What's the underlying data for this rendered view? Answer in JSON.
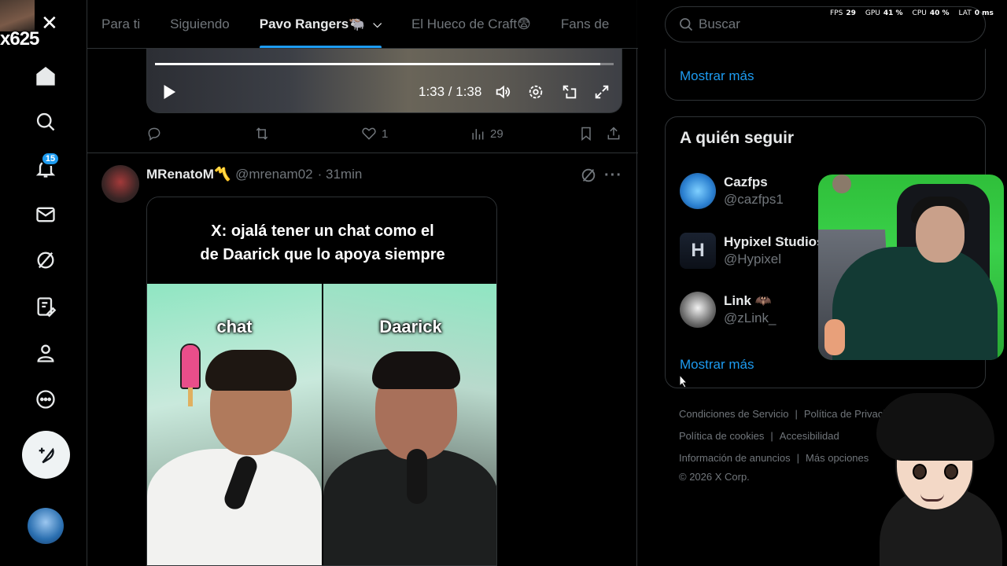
{
  "stream_overlay": {
    "counter": "x625",
    "stats": [
      {
        "label": "FPS",
        "value": "29"
      },
      {
        "label": "GPU",
        "value": "41 %"
      },
      {
        "label": "CPU",
        "value": "40 %"
      },
      {
        "label": "LAT",
        "value": "0 ms"
      }
    ]
  },
  "nav": {
    "notifications_badge": "15",
    "items": [
      "home-icon",
      "search-icon",
      "bell-icon",
      "mail-icon",
      "grok-icon",
      "notes-icon",
      "profile-icon",
      "more-icon"
    ]
  },
  "tabs": [
    {
      "label": "Para ti"
    },
    {
      "label": "Siguiendo"
    },
    {
      "label": "Pavo Rangers🐃"
    },
    {
      "label": "El Hueco de Craft😨"
    },
    {
      "label": "Fans de"
    }
  ],
  "video": {
    "time": "1:33 / 1:38",
    "progress": 0.97
  },
  "post_actions": {
    "likes": "1",
    "views": "29"
  },
  "tweet": {
    "name": "MRenatoM〽️",
    "handle": "@mrenam02",
    "time": "· 31min",
    "caption_line1": "X: ojalá tener un chat como el",
    "caption_line2": "de Daarick que lo apoya siempre",
    "label_left": "chat",
    "label_right": "Daarick"
  },
  "search": {
    "placeholder": "Buscar"
  },
  "sidebar": {
    "show_more_1": "Mostrar más",
    "who_to_follow_title": "A quién seguir",
    "who_to_follow": [
      {
        "name": "Cazfps",
        "handle": "@cazfps1"
      },
      {
        "name": "Hypixel Studios",
        "handle": "@Hypixel"
      },
      {
        "name": "Link 🦇",
        "handle": "@zLink_"
      }
    ],
    "show_more_2": "Mostrar más"
  },
  "footer": {
    "links_row1": [
      "Condiciones de Servicio",
      "Política de Privacidad"
    ],
    "links_row2": [
      "Política de cookies",
      "Accesibilidad"
    ],
    "links_row3": [
      "Información de anuncios",
      "Más opciones"
    ],
    "copyright": "© 2026 X Corp."
  }
}
